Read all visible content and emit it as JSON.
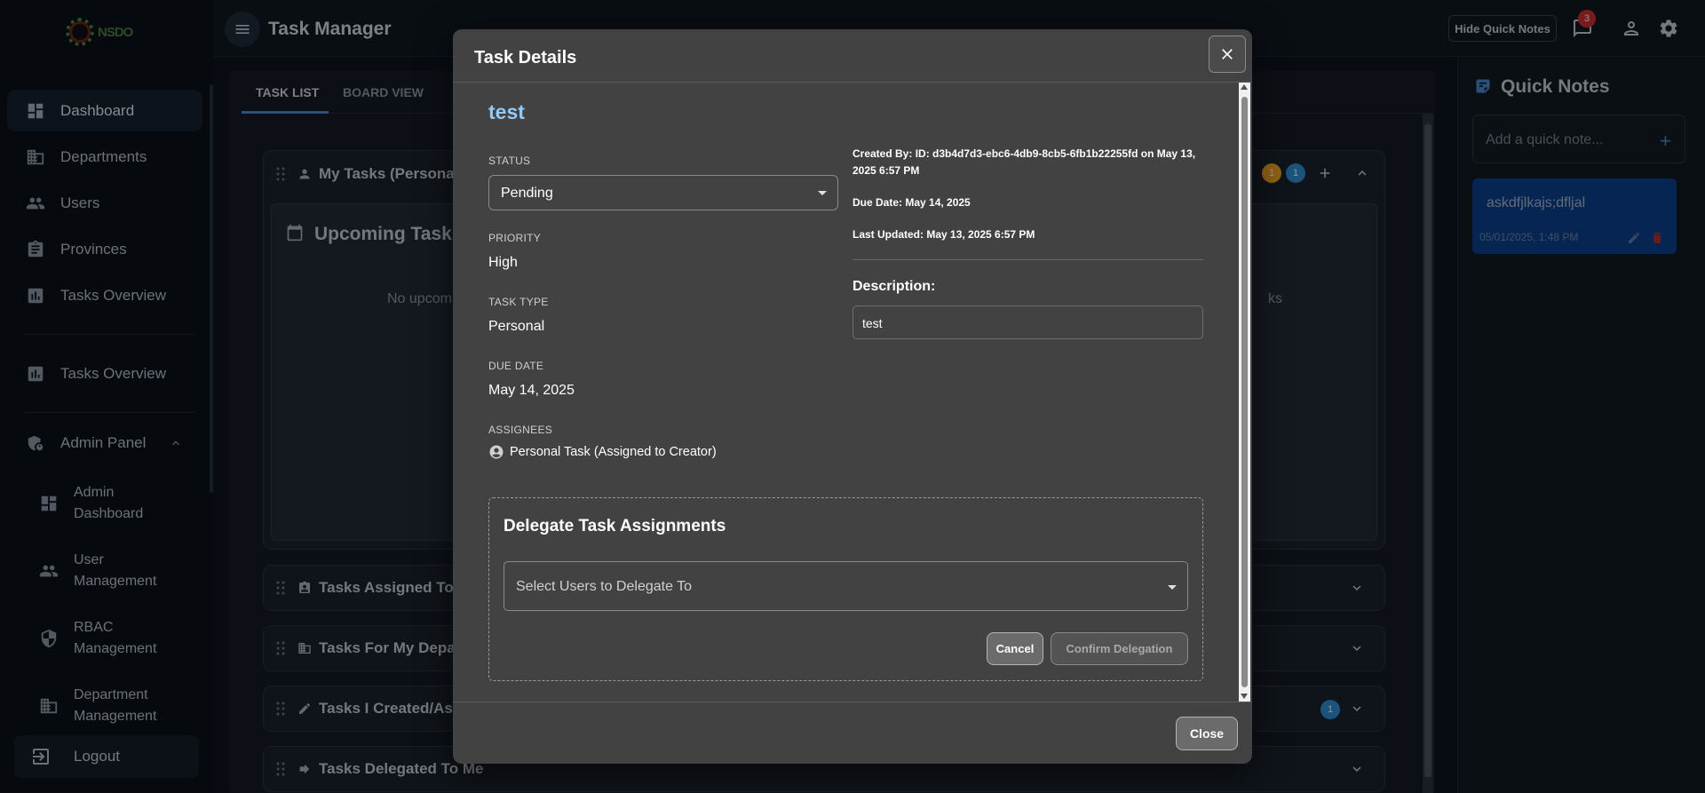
{
  "app": {
    "title": "Task Manager",
    "logo_text": "NSDO",
    "hide_quick_notes_label": "Hide Quick Notes",
    "notification_count": "3"
  },
  "sidebar": {
    "items": [
      {
        "label": "Dashboard",
        "icon": "dashboard-icon"
      },
      {
        "label": "Departments",
        "icon": "building-icon"
      },
      {
        "label": "Users",
        "icon": "users-icon"
      },
      {
        "label": "Provinces",
        "icon": "clipboard-icon"
      },
      {
        "label": "Tasks Overview",
        "icon": "chart-icon"
      },
      {
        "label": "Tasks Overview",
        "icon": "chart-icon"
      },
      {
        "label": "Admin Panel",
        "icon": "admin-shield-icon"
      }
    ],
    "admin_items": [
      {
        "label": "Admin Dashboard"
      },
      {
        "label": "User Management"
      },
      {
        "label": "RBAC Management"
      },
      {
        "label": "Department Management"
      }
    ],
    "logout_label": "Logout"
  },
  "main": {
    "tabs": [
      {
        "label": "TASK LIST"
      },
      {
        "label": "BOARD VIEW"
      }
    ],
    "sections": [
      {
        "title": "My Tasks (Personal)",
        "badges": [
          "1",
          "1"
        ]
      },
      {
        "title": "Tasks Assigned To M"
      },
      {
        "title": "Tasks For My Departn"
      },
      {
        "title": "Tasks I Created/Assi",
        "badges": [
          "1"
        ]
      },
      {
        "title": "Tasks Delegated To Me"
      }
    ],
    "upcoming": {
      "title": "Upcoming Tasks",
      "empty_left": "No upcom",
      "empty_right": "ks"
    }
  },
  "quick_notes": {
    "title": "Quick Notes",
    "input_placeholder": "Add a quick note...",
    "notes": [
      {
        "text": "askdfjlkajs;dfljal",
        "date": "05/01/2025, 1:48 PM"
      }
    ]
  },
  "modal": {
    "title": "Task Details",
    "task_name": "test",
    "status_label": "STATUS",
    "status_value": "Pending",
    "priority_label": "PRIORITY",
    "priority_value": "High",
    "task_type_label": "TASK TYPE",
    "task_type_value": "Personal",
    "due_date_label": "DUE DATE",
    "due_date_value": "May 14, 2025",
    "assignees_label": "ASSIGNEES",
    "assignee_value": "Personal Task (Assigned to Creator)",
    "created_by": "Created By: ID: d3b4d7d3-ebc6-4db9-8cb5-6fb1b22255fd on May 13, 2025 6:57 PM",
    "due_date_meta": "Due Date: May 14, 2025",
    "last_updated": "Last Updated: May 13, 2025 6:57 PM",
    "description_label": "Description:",
    "description_value": "test",
    "delegate": {
      "title": "Delegate Task Assignments",
      "select_placeholder": "Select Users to Delegate To",
      "cancel_label": "Cancel",
      "confirm_label": "Confirm Delegation"
    },
    "close_label": "Close"
  },
  "colors": {
    "accent": "#4a8ad6",
    "task_name": "#90caf9",
    "badge_orange": "#f5a623",
    "badge_blue": "#2e8fd6",
    "notification_red": "#d32f2f",
    "note_bg": "#0d47a1",
    "modal_bg": "#424242"
  }
}
